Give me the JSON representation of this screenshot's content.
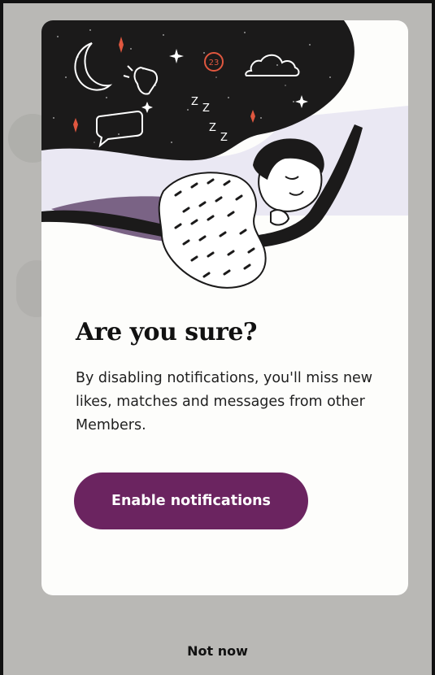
{
  "dialog": {
    "title": "Are you sure?",
    "body": "By disabling notifications, you'll miss new likes, matches and messages from other Members.",
    "primary_button": "Enable notifications",
    "secondary_button": "Not now"
  },
  "illustration": {
    "badge": "23",
    "icons": [
      "moon-icon",
      "waving-hand-icon",
      "cloud-icon",
      "chat-bubble-icon",
      "sparkle-icon",
      "sleeping-person-illustration"
    ]
  },
  "colors": {
    "accent": "#6b2460",
    "night": "#1b1a1a",
    "sparkle": "#e0573f",
    "blanket": "#7a6385"
  }
}
